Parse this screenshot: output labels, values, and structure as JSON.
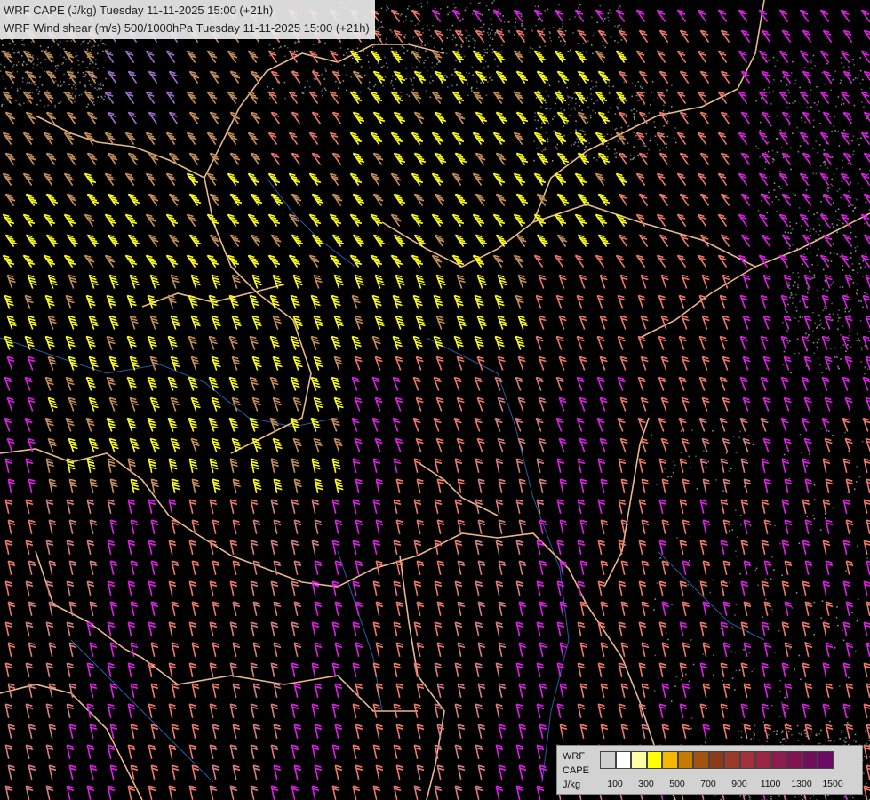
{
  "titles": [
    "WRF CAPE (J/kg) Tuesday 11-11-2025 15:00 (+21h)",
    "WRF Wind shear (m/s) 500/1000hPa Tuesday 11-11-2025 15:00 (+21h)"
  ],
  "legend": {
    "model": "WRF",
    "variable": "CAPE",
    "unit": "J/kg",
    "colors": [
      "#cfcfcf",
      "#ffffff",
      "#ffffa6",
      "#ffff00",
      "#f5b800",
      "#c77a00",
      "#a35212",
      "#8c3a1a",
      "#9b3a2a",
      "#a3303c",
      "#9a2644",
      "#8c1c4c",
      "#7e1450",
      "#70105a",
      "#6a0a64"
    ],
    "ticks": [
      "100",
      "300",
      "500",
      "700",
      "900",
      "1100",
      "1300",
      "1500"
    ]
  },
  "barb_colors": {
    "yellow": "#ffff1a",
    "tan": "#c8905a",
    "salmon": "#f07a6a",
    "magenta": "#e020e8",
    "lilac": "#a070d0",
    "rose": "#d88080"
  },
  "border_color": "#e8b88a",
  "river_color": "#2a5aa8"
}
